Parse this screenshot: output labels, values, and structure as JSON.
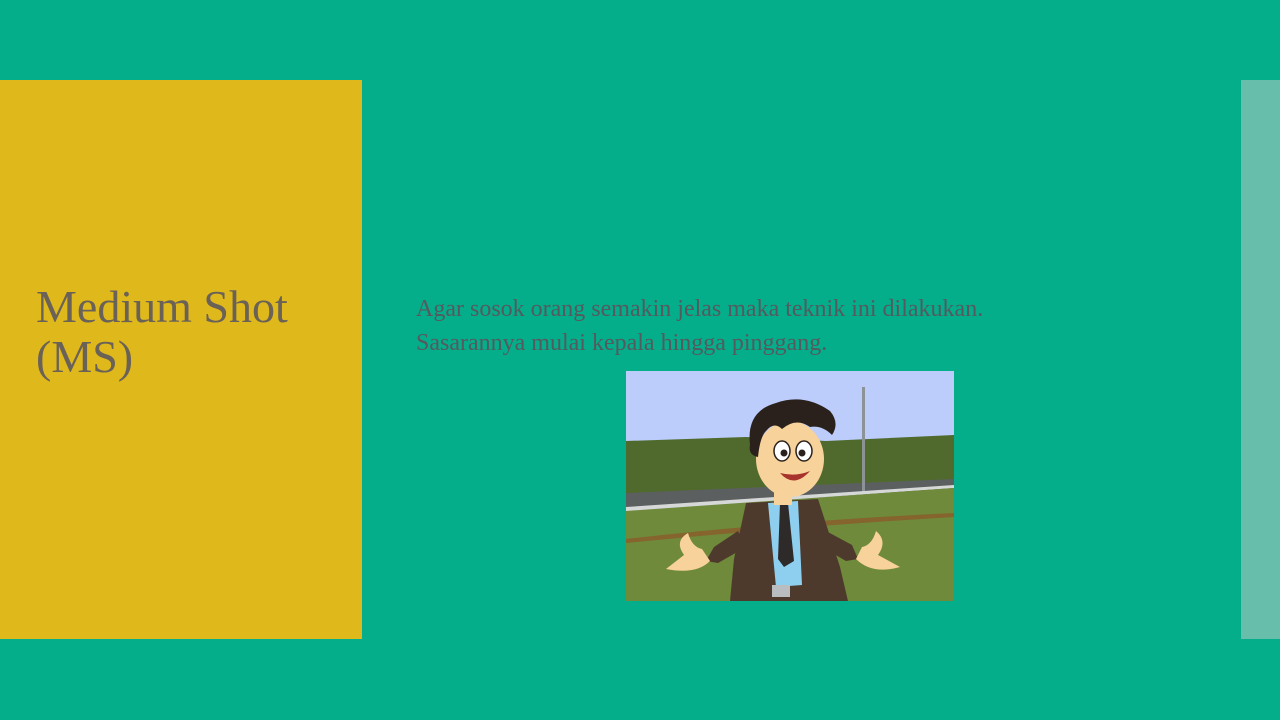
{
  "slide": {
    "title": "Medium Shot (MS)",
    "body_lines": [
      "Agar sosok orang semakin jelas maka teknik ini dilakukan.",
      "Sasarannya mulai kepala hingga pinggang."
    ]
  },
  "colors": {
    "background": "#04ae8b",
    "left_panel": "#dfb81b",
    "right_strip": "#66beab",
    "title_text": "#6b6257",
    "body_text": "#555a5e"
  },
  "image": {
    "icon": "cartoon-man-medium-shot-illustration"
  }
}
